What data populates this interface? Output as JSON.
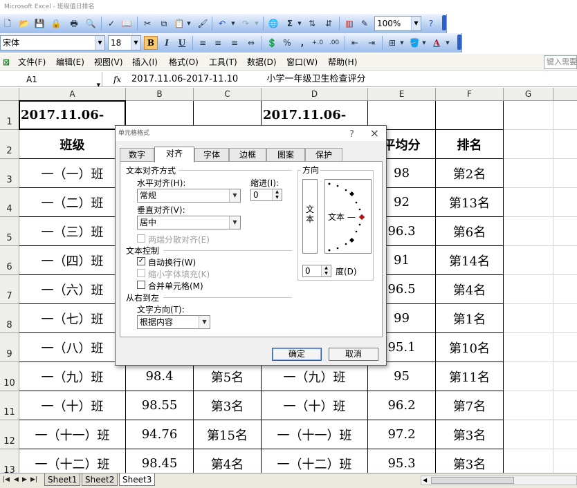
{
  "window": {
    "title": "Microsoft Excel - 班级值日排名"
  },
  "toolbar": {
    "font_name": "宋体",
    "font_size": "18",
    "bold": "B",
    "italic": "I",
    "underline": "U",
    "zoom": "100%",
    "sum": "Σ",
    "percent": "%",
    "comma": ",",
    "font_color": "A",
    "help": "?"
  },
  "menu": {
    "items": [
      "文件(F)",
      "编辑(E)",
      "视图(V)",
      "插入(I)",
      "格式(O)",
      "工具(T)",
      "数据(D)",
      "窗口(W)",
      "帮助(H)"
    ],
    "help_search_placeholder": "键入需要"
  },
  "formula_bar": {
    "name_box": "A1",
    "fx": "fx",
    "content": "2017.11.06-2017-11.10          小学一年级卫生检查评分"
  },
  "columns": [
    "A",
    "B",
    "C",
    "D",
    "E",
    "F",
    "G"
  ],
  "rows": [
    "1",
    "2",
    "3",
    "4",
    "5",
    "6",
    "7",
    "8",
    "9",
    "10",
    "11",
    "12",
    "13"
  ],
  "cells": {
    "A1": "2017.11.06-",
    "D1": "2017.11.06-",
    "A2": "班级",
    "E2": "平均分",
    "F2": "排名",
    "A3": "一（一）班",
    "E3": "98",
    "F3": "第2名",
    "A4": "一（二）班",
    "E4": "92",
    "F4": "第13名",
    "A5": "一（三）班",
    "E5": "96.3",
    "F5": "第6名",
    "A6": "一（四）班",
    "E6": "91",
    "F6": "第14名",
    "A7": "一（六）班",
    "E7": "96.5",
    "F7": "第4名",
    "A8": "一（七）班",
    "E8": "99",
    "F8": "第1名",
    "A9": "一（八）班",
    "E9": "95.1",
    "F9": "第10名",
    "A10": "一（九）班",
    "B10": "98.4",
    "C10": "第5名",
    "D10": "一（九）班",
    "E10": "95",
    "F10": "第11名",
    "A11": "一（十）班",
    "B11": "98.55",
    "C11": "第3名",
    "D11": "一（十）班",
    "E11": "96.2",
    "F11": "第7名",
    "A12": "一（十一）班",
    "B12": "94.76",
    "C12": "第15名",
    "D12": "一（十一）班",
    "E12": "97.2",
    "F12": "第3名",
    "A13": "一（十二）班",
    "B13": "98.45",
    "C13": "第4名",
    "D13": "一（十二）班",
    "E13": "95.3",
    "F13": "第3名"
  },
  "sheet_tabs": [
    "Sheet1",
    "Sheet2",
    "Sheet3"
  ],
  "active_sheet": "Sheet3",
  "dialog": {
    "title": "单元格格式",
    "help": "?",
    "close": "×",
    "tabs": [
      "数字",
      "对齐",
      "字体",
      "边框",
      "图案",
      "保护"
    ],
    "active_tab": "对齐",
    "text_alignment_group": "文本对齐方式",
    "horizontal_label": "水平对齐(H):",
    "horizontal_value": "常规",
    "indent_label": "缩进(I):",
    "indent_value": "0",
    "vertical_label": "垂直对齐(V):",
    "vertical_value": "居中",
    "distributed_label": "两端分散对齐(E)",
    "text_control_group": "文本控制",
    "wrap_text_label": "自动换行(W)",
    "wrap_text_checked": true,
    "shrink_label": "缩小字体填充(K)",
    "merge_label": "合并单元格(M)",
    "rtl_group": "从右到左",
    "text_direction_label": "文字方向(T):",
    "text_direction_value": "根据内容",
    "orientation_group": "方向",
    "vertical_text": "文本",
    "dial_text": "文本 —",
    "degree_value": "0",
    "degree_label": "度(D)",
    "ok": "确定",
    "cancel": "取消"
  }
}
